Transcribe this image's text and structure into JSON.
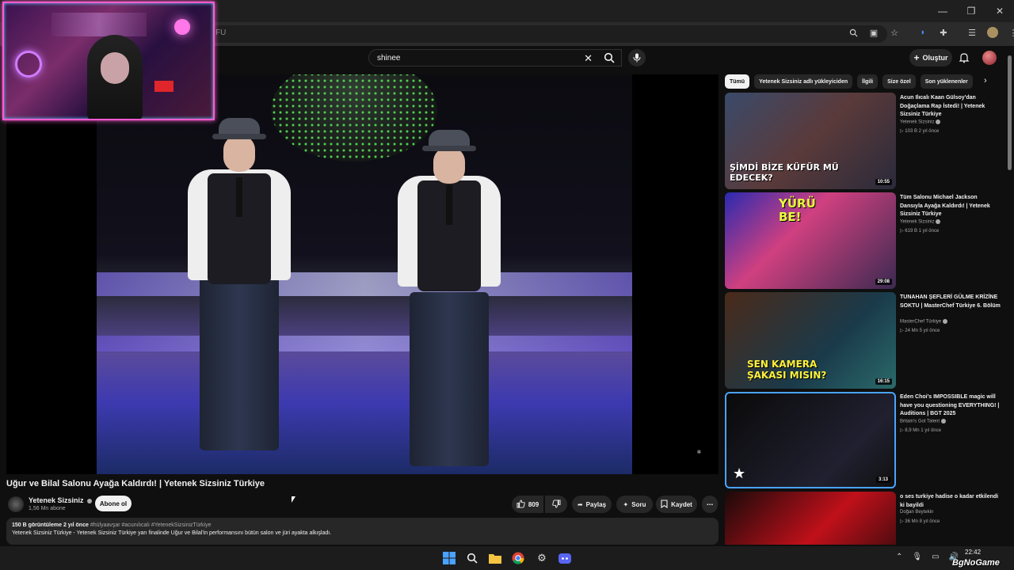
{
  "browser": {
    "url_fragment": "FU"
  },
  "header": {
    "search_value": "shinee",
    "create_label": "Oluştur"
  },
  "video": {
    "title": "Uğur ve Bilal Salonu Ayağa Kaldırdı! | Yetenek Sizsiniz Türkiye",
    "channel": "Yetenek Sizsiniz",
    "subscribers": "1,56 Mn abone",
    "subscribe_label": "Abone ol",
    "likes": "809",
    "share_label": "Paylaş",
    "ask_label": "Soru",
    "save_label": "Kaydet",
    "views_time": "150 B görüntüleme  2 yıl önce",
    "hashtags": "#hülyaavşar #acunılıcalı #YetenekSizsinizTürkiye",
    "description": "Yetenek Sizsiniz Türkiye -  Yetenek Sizsiniz Türkiye yarı finalinde Uğur ve Bilal'in performansını bütün salon ve jüri ayakta alkışladı."
  },
  "chips": [
    "Tümü",
    "Yetenek Sizsiniz adlı yükleyiciden",
    "İlgili",
    "Size özel",
    "Son yüklenenler"
  ],
  "recommendations": [
    {
      "title": "Acun Ilıcalı Kaan Gülsoy'dan Doğaçlama Rap İstedi! | Yetenek Sizsiniz Türkiye",
      "channel": "Yetenek Sizsiniz",
      "meta": "▷ 103 B  2 yıl önce",
      "duration": "10:55",
      "caption": "ŞİMDİ BİZE KÜFÜR MÜ EDECEK?"
    },
    {
      "title": "Tüm Salonu Michael Jackson Dansıyla Ayağa Kaldırdı! | Yetenek Sizsiniz Türkiye",
      "channel": "Yetenek Sizsiniz",
      "meta": "▷ 619 B  1 yıl önce",
      "duration": "29:08",
      "caption": "YÜRÜ BE!"
    },
    {
      "title": "TUNAHAN ŞEFLERİ GÜLME KRİZİNE SOKTU | MasterChef Türkiye 6. Bölüm",
      "channel": "MasterChef Türkiye",
      "meta": "▷ 24 Mn  5 yıl önce",
      "duration": "16:15",
      "caption": "SEN KAMERA ŞAKASI MISIN?"
    },
    {
      "title": "Eden Choi's IMPOSSIBLE magic will have you questioning EVERYTHING! | Auditions | BGT 2025",
      "channel": "Britain's Got Talent",
      "meta": "▷ 8,9 Mn  1 yıl önce",
      "duration": "3:13",
      "caption": ""
    },
    {
      "title": "o ses turkiye  hadise o kadar etkilendi ki bayildi",
      "channel": "Doğan Beytekin",
      "meta": "▷ 36 Mn  8 yıl önce",
      "duration": "",
      "caption": ""
    }
  ],
  "taskbar": {
    "time": "22:42"
  },
  "watermark": "BgNoGame"
}
